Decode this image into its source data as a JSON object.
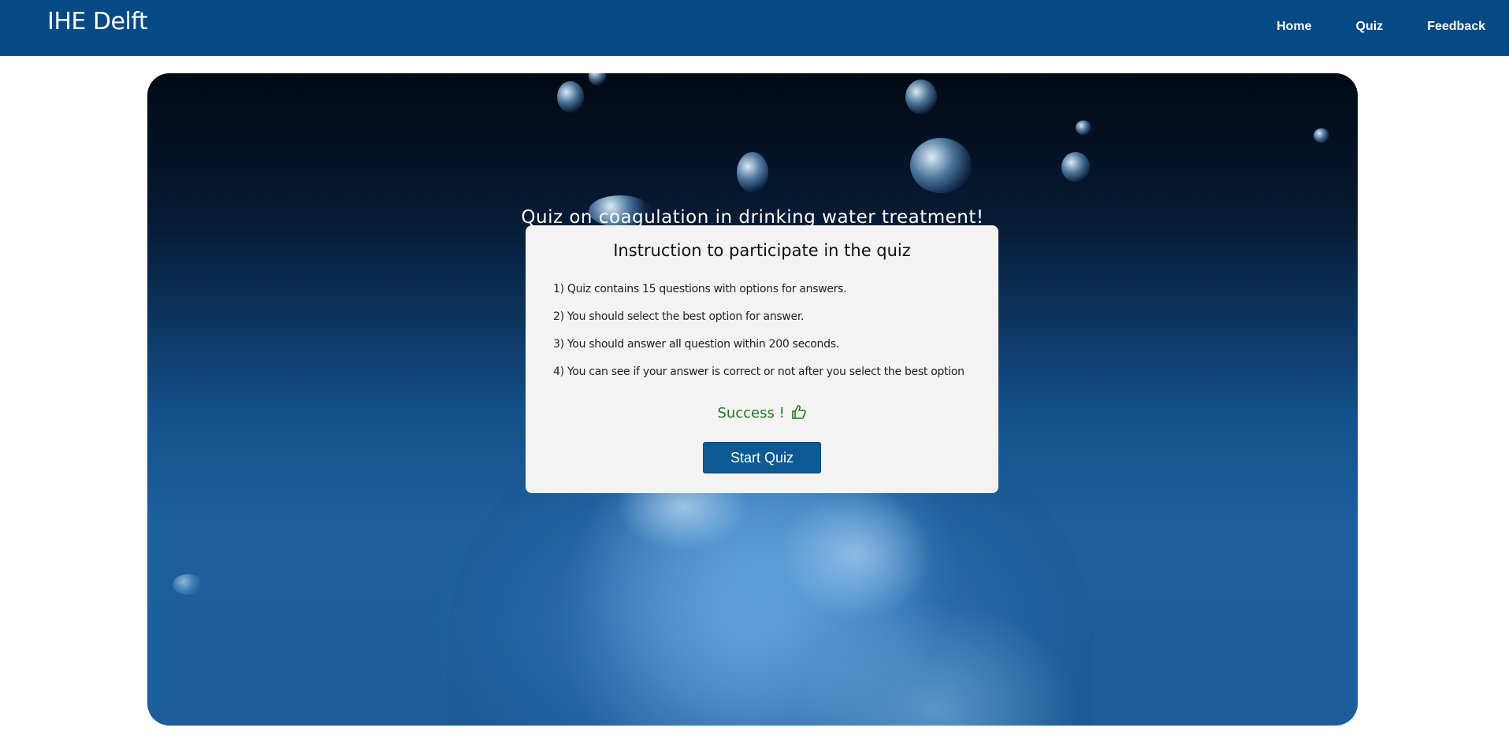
{
  "navbar": {
    "brand": "IHE Delft",
    "links": [
      "Home",
      "Quiz",
      "Feedback"
    ]
  },
  "hero": {
    "title": "Quiz on coagulation in drinking water treatment!"
  },
  "instructions": {
    "title": "Instruction to participate in the quiz",
    "rules": [
      "1) Quiz contains 15 questions with options for answers.",
      "2) You should select the best option for answer.",
      "3) You should answer all question within 200 seconds.",
      "4) You can see if your answer is correct or not after you select the best option"
    ],
    "status": "Success !",
    "status_icon": "thumbs-up-icon",
    "start_label": "Start Quiz"
  },
  "colors": {
    "navbar": "#064a85",
    "button": "#0b5a96",
    "success": "#1a7a1a",
    "card": "#f3f3f3"
  }
}
